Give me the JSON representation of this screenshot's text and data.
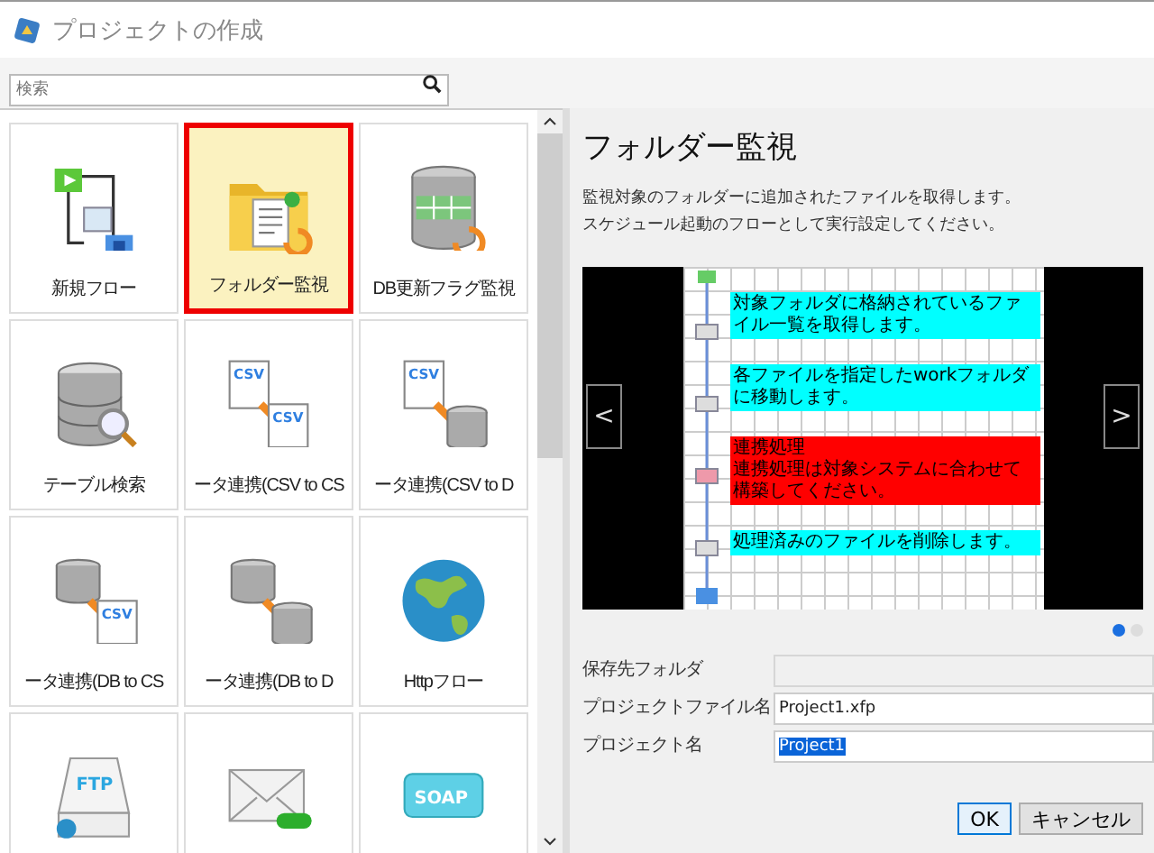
{
  "window": {
    "title": "プロジェクトの作成"
  },
  "search": {
    "placeholder": "検索"
  },
  "tiles": [
    {
      "kind": "flow",
      "label": "新規フロー",
      "selected": false
    },
    {
      "kind": "folder",
      "label": "フォルダー監視",
      "selected": true
    },
    {
      "kind": "db-flag",
      "label": "DB更新フラグ監視",
      "selected": false
    },
    {
      "kind": "db-search",
      "label": "テーブル検索",
      "selected": false
    },
    {
      "kind": "csv-csv",
      "icon_texts": [
        "CSV",
        "CSV"
      ],
      "label": "ータ連携(CSV to CS",
      "selected": false
    },
    {
      "kind": "csv-db",
      "icon_texts": [
        "CSV"
      ],
      "label": "ータ連携(CSV to D",
      "selected": false
    },
    {
      "kind": "db-csv",
      "icon_texts": [
        "CSV"
      ],
      "label": "ータ連携(DB to CS",
      "selected": false
    },
    {
      "kind": "db-db",
      "label": "ータ連携(DB to D",
      "selected": false
    },
    {
      "kind": "globe",
      "label": "Httpフロー",
      "selected": false
    },
    {
      "kind": "ftp",
      "icon_texts": [
        "FTP"
      ],
      "selected": false
    },
    {
      "kind": "mail",
      "selected": false
    },
    {
      "kind": "soap",
      "icon_texts": [
        "SOAP"
      ],
      "selected": false
    }
  ],
  "detail": {
    "title": "フォルダー監視",
    "description": [
      "監視対象のフォルダーに追加されたファイルを取得します。",
      "スケジュール起動のフローとして実行設定してください。"
    ],
    "carousel": {
      "prev": "<",
      "next": ">",
      "notes": [
        {
          "color": "#00ffff",
          "text": "対象フォルダに格納されているファイル一覧を取得します。"
        },
        {
          "color": "#00ffff",
          "text": "各ファイルを指定したworkフォルダに移動します。"
        },
        {
          "color": "#ff0000",
          "title": "連携処理",
          "text": "連携処理は対象システムに合わせて構築してください。"
        },
        {
          "color": "#00ffff",
          "text": "処理済みのファイルを削除します。"
        }
      ],
      "pages": [
        {
          "selected": true
        },
        {
          "selected": false
        }
      ]
    }
  },
  "fields": [
    {
      "label": "保存先フォルダ",
      "disabled": true,
      "highlighted": false
    },
    {
      "label": "プロジェクトファイル名",
      "value": "Project1.xfp",
      "disabled": false,
      "highlighted": false
    },
    {
      "label": "プロジェクト名",
      "value": "Project1",
      "disabled": false,
      "highlighted": true
    }
  ],
  "buttons": [
    {
      "label": "OK",
      "default": true
    },
    {
      "label": "キャンセル",
      "default": false
    }
  ]
}
